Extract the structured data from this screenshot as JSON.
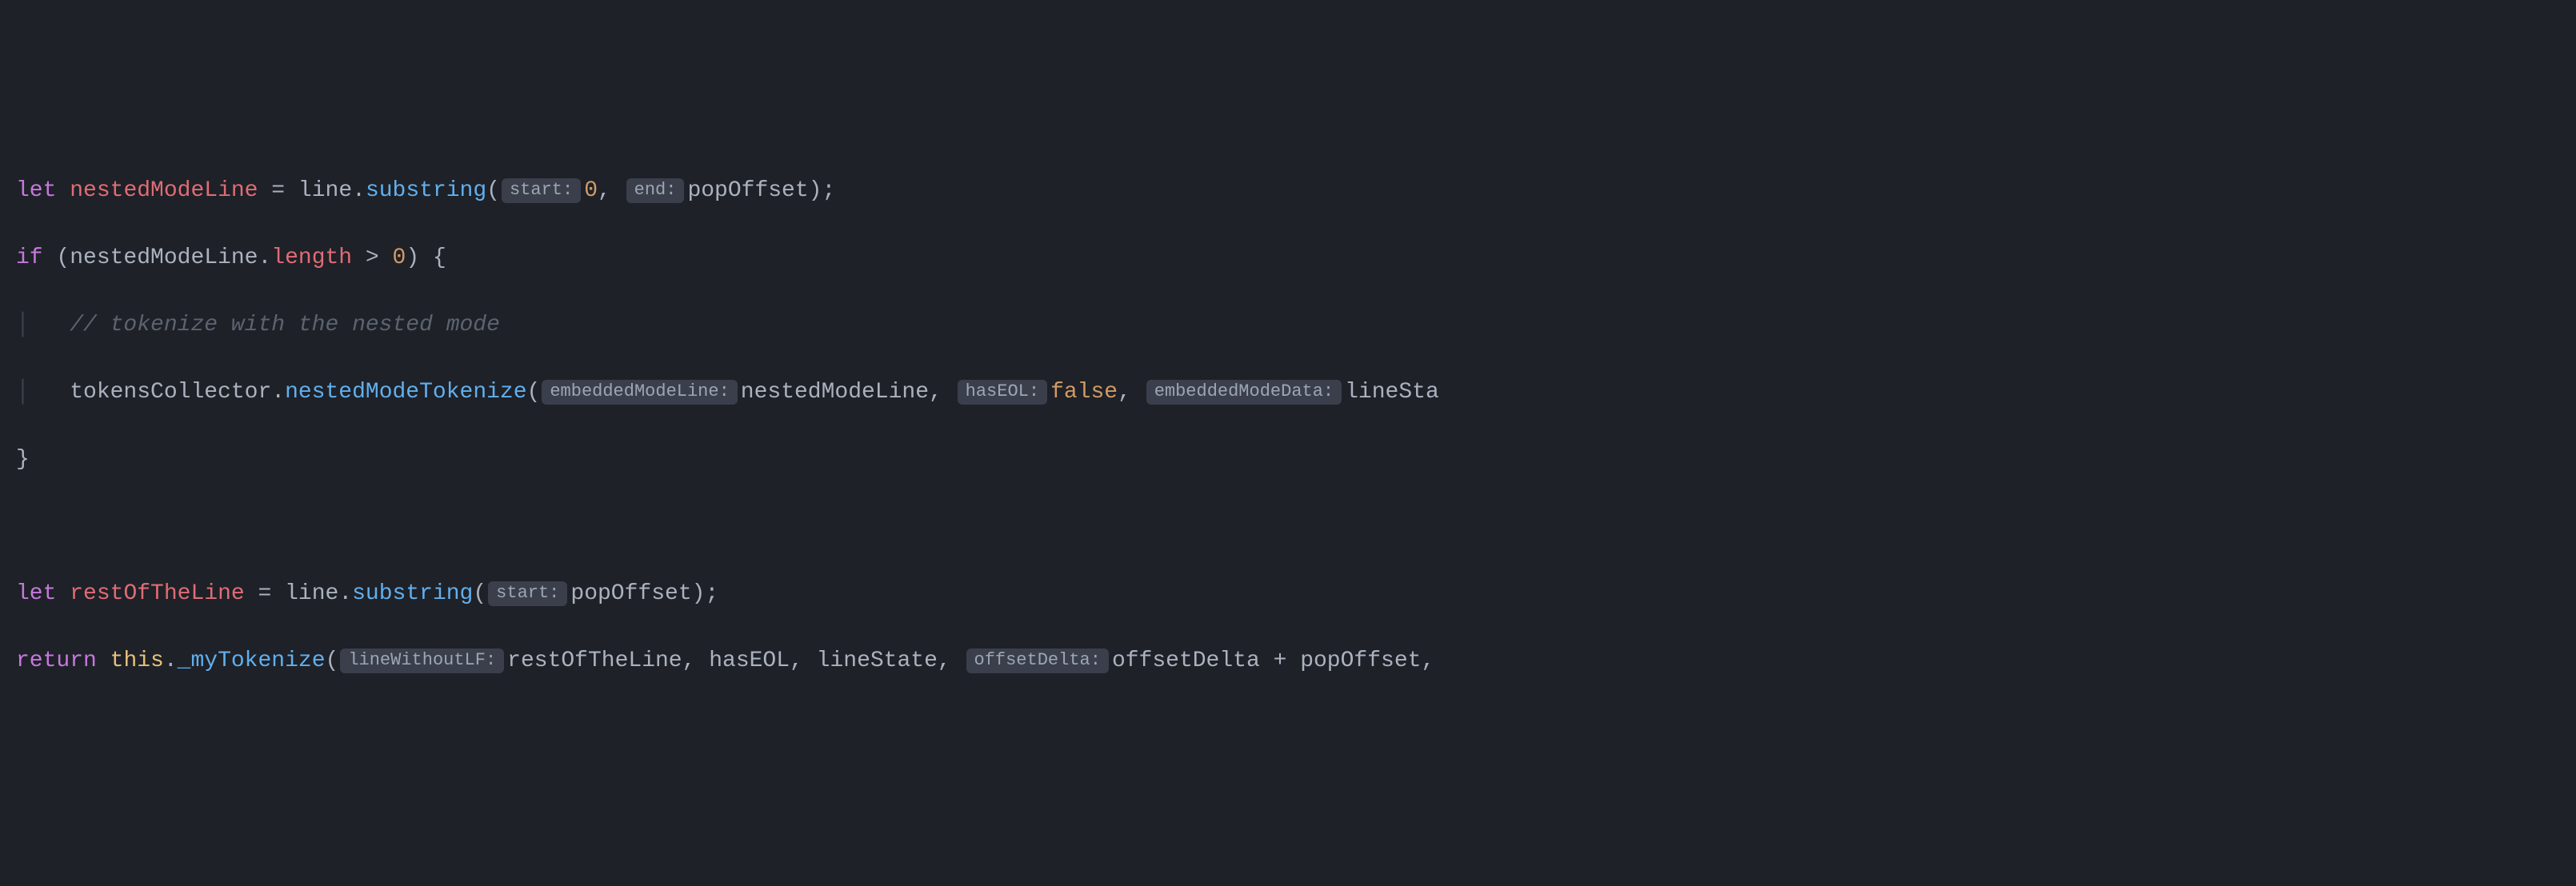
{
  "code": {
    "line1": {
      "let": "let",
      "var": "nestedModeLine",
      "eq": " = ",
      "obj": "line",
      "dot": ".",
      "method": "substring",
      "lp": "(",
      "hint1": "start:",
      "arg1": "0",
      "comma": ", ",
      "hint2": "end:",
      "arg2": "popOffset",
      "rp": ")",
      "semi": ";"
    },
    "line2": {
      "if": "if",
      "lp": " (",
      "var": "nestedModeLine",
      "dot": ".",
      "prop": "length",
      "op": " > ",
      "num": "0",
      "rp": ") ",
      "brace": "{"
    },
    "line3": {
      "indent_guide": "│   ",
      "comment": "// tokenize with the nested mode"
    },
    "line4": {
      "indent_guide": "│   ",
      "obj": "tokensCollector",
      "dot": ".",
      "method": "nestedModeTokenize",
      "lp": "(",
      "hint1": "embeddedModeLine:",
      "arg1": "nestedModeLine",
      "comma1": ", ",
      "hint2": "hasEOL:",
      "arg2": "false",
      "comma2": ", ",
      "hint3": "embeddedModeData:",
      "arg3": "lineSta"
    },
    "line5": {
      "brace": "}"
    },
    "line7": {
      "let": "let",
      "var": "restOfTheLine",
      "eq": " = ",
      "obj": "line",
      "dot": ".",
      "method": "substring",
      "lp": "(",
      "hint1": "start:",
      "arg1": "popOffset",
      "rp": ")",
      "semi": ";"
    },
    "line8": {
      "return": "return",
      "sp": " ",
      "this": "this",
      "dot": ".",
      "method": "_myTokenize",
      "lp": "(",
      "hint1": "lineWithoutLF:",
      "arg1": "restOfTheLine",
      "comma1": ", ",
      "arg2": "hasEOL",
      "comma2": ", ",
      "arg3": "lineState",
      "comma3": ", ",
      "hint2": "offsetDelta:",
      "arg4a": "offsetDelta",
      "plus": " + ",
      "arg4b": "popOffset",
      "comma4": ","
    }
  }
}
